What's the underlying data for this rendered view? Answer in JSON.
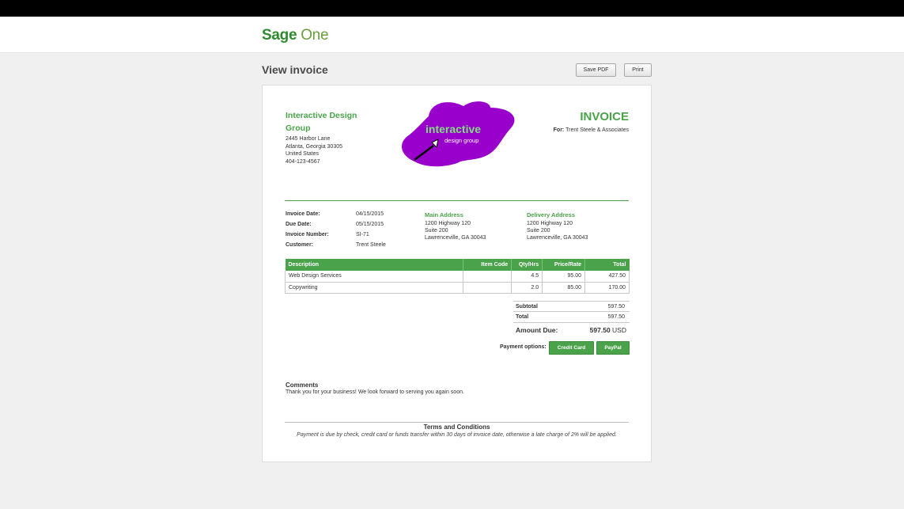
{
  "app": {
    "brand_sage": "Sage",
    "brand_one": "One"
  },
  "page": {
    "title": "View invoice",
    "save_pdf_label": "Save PDF",
    "print_label": "Print"
  },
  "invoice": {
    "company_name": "Interactive Design Group",
    "address_lines": [
      "2445 Harbor Lane",
      "Atlanta, Georgia 30305",
      "United States",
      "404-123-4567"
    ],
    "logo_text_main": "interactive",
    "logo_text_sub": "design group",
    "heading": "INVOICE",
    "for_label": "For:",
    "for_value": "Trent Steele & Associates",
    "meta": [
      {
        "label": "Invoice Date:",
        "value": "04/15/2015"
      },
      {
        "label": "Due Date:",
        "value": "05/15/2015"
      },
      {
        "label": "Invoice Number:",
        "value": "SI-71"
      },
      {
        "label": "Customer:",
        "value": "Trent Steele"
      }
    ],
    "main_address": {
      "heading": "Main Address",
      "lines": [
        "1200 Highway 120",
        "Suite 200",
        "Lawrenceville, GA 30043"
      ]
    },
    "delivery_address": {
      "heading": "Delivery Address",
      "lines": [
        "1200 Highway 120",
        "Suite 200",
        "Lawrenceville, GA 30043"
      ]
    },
    "table": {
      "headers": [
        "Description",
        "Item Code",
        "Qty/Hrs",
        "Price/Rate",
        "Total"
      ],
      "rows": [
        [
          "Web Design Services",
          "",
          "4.5",
          "95.00",
          "427.50"
        ],
        [
          "Copywriting",
          "",
          "2.0",
          "85.00",
          "170.00"
        ]
      ]
    },
    "totals": {
      "subtotal_label": "Subtotal",
      "subtotal_value": "597.50",
      "total_label": "Total",
      "total_value": "597.50",
      "amount_due_label": "Amount Due:",
      "amount_due_value": "597.50",
      "currency": "USD"
    },
    "payment": {
      "label": "Payment options:",
      "credit_card_label": "Credit Card",
      "paypal_label": "PayPal"
    },
    "comments": {
      "heading": "Comments",
      "text": "Thank you for your business! We look forward to serving you again soon."
    },
    "terms": {
      "heading": "Terms and Conditions",
      "text": "Payment is due by check, credit card or funds transfer within 30 days of invoice date, otherwise a late charge of 2% will be applied."
    }
  },
  "colors": {
    "accent": "#4aa34a",
    "logo_purple": "#9900cc",
    "topbar": "#000000"
  }
}
